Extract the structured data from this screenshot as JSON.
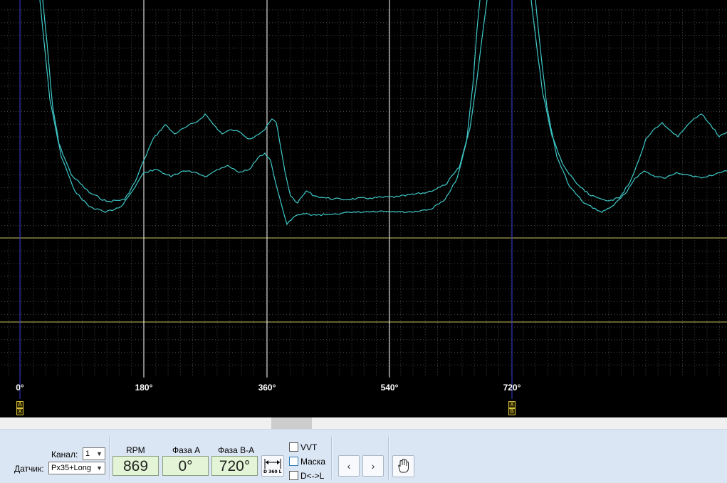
{
  "plot": {
    "colors": {
      "background": "#000000",
      "grid_dot": "#4a4a4a",
      "trace": "#3fc8c8",
      "marker_line": "#3a3ad8",
      "phase_line": "#ffffff",
      "level_line": "#c8c060"
    },
    "degree_labels": [
      "0°",
      "180°",
      "360°",
      "540°",
      "720°"
    ],
    "marker_a": {
      "top": "A",
      "bottom": "X"
    },
    "marker_b": {
      "top": "X",
      "bottom": "B"
    }
  },
  "toolbar": {
    "channel_label": "Канал:",
    "channel_value": "1",
    "sensor_label": "Датчик:",
    "sensor_value": "Px35+Long",
    "rpm_label": "RPM",
    "rpm_value": "869",
    "phase_a_label": "Фаза A",
    "phase_a_value": "0°",
    "phase_ba_label": "Фаза B-A",
    "phase_ba_value": "720°",
    "d360_label": "D 360 L",
    "vvt_label": "VVT",
    "mask_label": "Маска",
    "dl_label": "D<->L",
    "prev_icon": "chevron-left-icon",
    "next_icon": "chevron-right-icon",
    "hand_icon": "hand-pan-icon"
  }
}
